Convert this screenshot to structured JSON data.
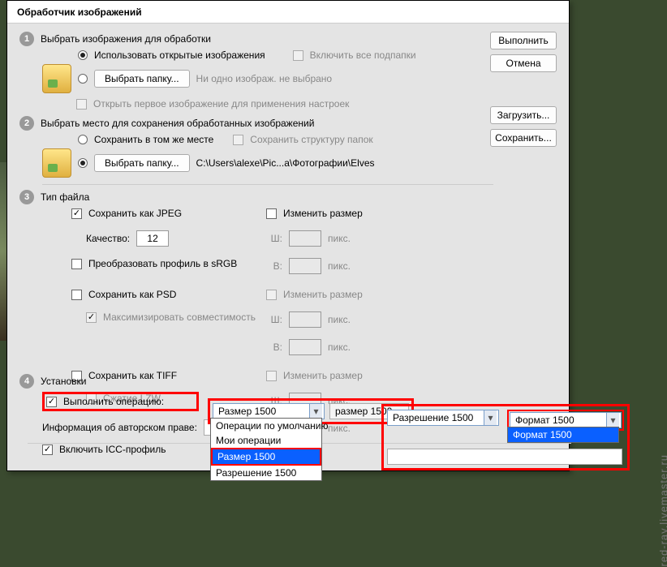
{
  "title": "Обработчик изображений",
  "buttons": {
    "run": "Выполнить",
    "cancel": "Отмена",
    "load": "Загрузить...",
    "save": "Сохранить...",
    "pick": "Выбрать папку..."
  },
  "s1": {
    "num": "1",
    "title": "Выбрать изображения для обработки",
    "useOpen": "Использовать открытые изображения",
    "subfolders": "Включить все подпапки",
    "none": "Ни одно изображ. не выбрано",
    "openFirst": "Открыть первое изображение для применения настроек"
  },
  "s2": {
    "num": "2",
    "title": "Выбрать место для сохранения обработанных изображений",
    "same": "Сохранить в том же месте",
    "keep": "Сохранить структуру папок",
    "path": "C:\\Users\\alexe\\Pic...a\\Фотографии\\Elves"
  },
  "s3": {
    "num": "3",
    "title": "Тип файла",
    "jpeg": "Сохранить как JPEG",
    "quality": "Качество:",
    "qval": "12",
    "icc": "Преобразовать профиль в sRGB",
    "psd": "Сохранить как PSD",
    "maxcompat": "Максимизировать совместимость",
    "tiff": "Сохранить как TIFF",
    "lzw": "Сжатие LZW",
    "resize": "Изменить размер",
    "w": "Ш:",
    "h": "В:",
    "px": "пикс."
  },
  "s4": {
    "num": "4",
    "title": "Установки",
    "runAction": "Выполнить операцию:",
    "copyright": "Информация об авторском праве:",
    "iccProfile": "Включить ICC-профиль",
    "dd1_sel": "Размер 1500",
    "dd1_items": [
      "Операции по умолчанию",
      "Мои операции",
      "Размер 1500",
      "Разрешение 1500"
    ],
    "dd2_sel": "размер 1500",
    "ext1_sel": "Разрешение 1500",
    "ext2_sel": "Формат 1500",
    "ext2_item": "Формат 1500"
  },
  "watermark": "red-ray.livemaster.ru"
}
